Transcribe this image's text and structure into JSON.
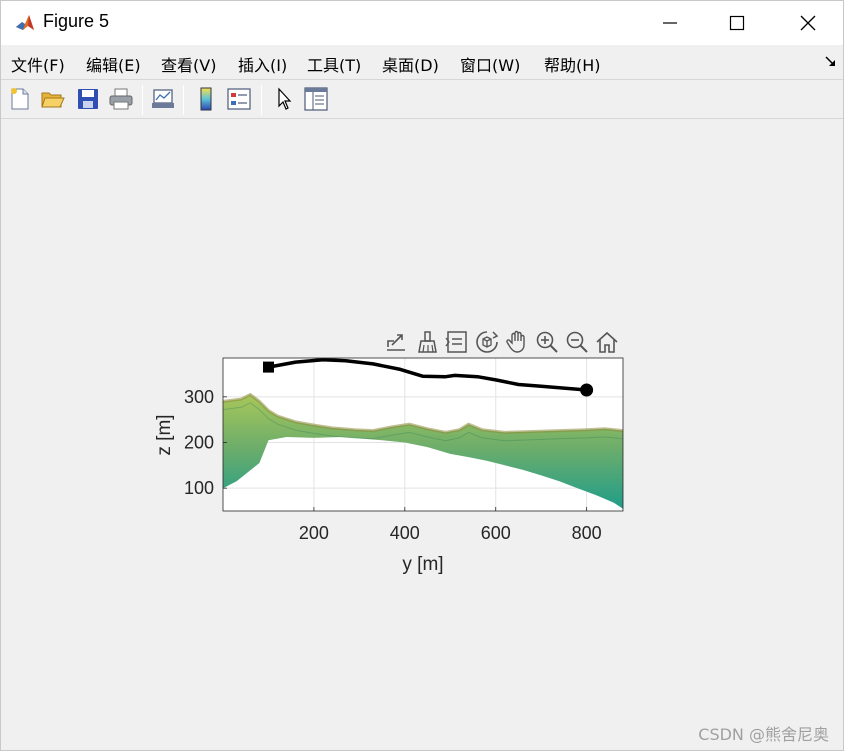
{
  "window": {
    "title": "Figure 5",
    "icon": "matlab-logo-icon",
    "controls": {
      "minimize": "minimize-icon",
      "maximize": "maximize-icon",
      "close": "close-icon"
    }
  },
  "menubar": {
    "items": [
      {
        "label": "文件(F)",
        "id": "file"
      },
      {
        "label": "编辑(E)",
        "id": "edit"
      },
      {
        "label": "查看(V)",
        "id": "view"
      },
      {
        "label": "插入(I)",
        "id": "insert"
      },
      {
        "label": "工具(T)",
        "id": "tools"
      },
      {
        "label": "桌面(D)",
        "id": "desktop"
      },
      {
        "label": "窗口(W)",
        "id": "window"
      },
      {
        "label": "帮助(H)",
        "id": "help"
      }
    ],
    "dock_icon": "dock-arrow-icon"
  },
  "toolbar": {
    "items": [
      "new-figure-icon",
      "open-file-icon",
      "save-icon",
      "print-icon",
      "link-plot-icon",
      "colorbar-icon",
      "legend-icon",
      "edit-plot-icon",
      "property-inspector-icon"
    ]
  },
  "axes_toolbar": {
    "items": [
      "export-icon",
      "brush-icon",
      "data-tips-icon",
      "rotate-3d-icon",
      "pan-icon",
      "zoom-in-icon",
      "zoom-out-icon",
      "restore-view-icon"
    ]
  },
  "chart_data": {
    "type": "line",
    "title": "",
    "xlabel": "y [m]",
    "ylabel": "z [m]",
    "xlim": [
      0,
      880
    ],
    "ylim": [
      50,
      385
    ],
    "xticks": [
      200,
      400,
      600,
      800
    ],
    "yticks": [
      100,
      200,
      300
    ],
    "grid": true,
    "series": [
      {
        "style": "black-thick-line",
        "x": [
          100,
          160,
          220,
          270,
          330,
          390,
          440,
          490,
          510,
          560,
          600,
          650,
          700,
          750,
          800
        ],
        "y": [
          365,
          376,
          381,
          379,
          372,
          360,
          345,
          344,
          347,
          344,
          337,
          327,
          323,
          319,
          315
        ]
      }
    ],
    "markers": [
      {
        "kind": "start-square",
        "x": 100,
        "y": 365
      },
      {
        "kind": "goal-circle",
        "x": 800,
        "y": 315
      }
    ],
    "terrain": {
      "top_x": [
        0,
        40,
        60,
        80,
        100,
        120,
        160,
        200,
        240,
        290,
        330,
        370,
        410,
        450,
        490,
        520,
        540,
        570,
        620,
        680,
        740,
        800,
        840,
        880
      ],
      "top_y": [
        290,
        295,
        305,
        290,
        270,
        258,
        245,
        238,
        232,
        228,
        226,
        234,
        240,
        230,
        222,
        228,
        240,
        228,
        222,
        224,
        226,
        228,
        230,
        226
      ],
      "bottom_x": [
        0,
        30,
        80,
        100,
        140,
        200,
        260,
        310,
        350,
        400,
        450,
        500,
        540,
        580,
        620,
        660,
        700,
        740,
        780,
        820,
        860,
        880
      ],
      "bottom_y": [
        100,
        115,
        155,
        205,
        212,
        210,
        212,
        208,
        205,
        200,
        190,
        175,
        168,
        160,
        150,
        140,
        128,
        115,
        100,
        85,
        68,
        55
      ],
      "colors": {
        "top": "#a8c75a",
        "mid": "#6fae6a",
        "bottom": "#1f9d8a",
        "peak": "#8a8a3a"
      }
    }
  },
  "watermark": "CSDN @熊舍尼奥"
}
